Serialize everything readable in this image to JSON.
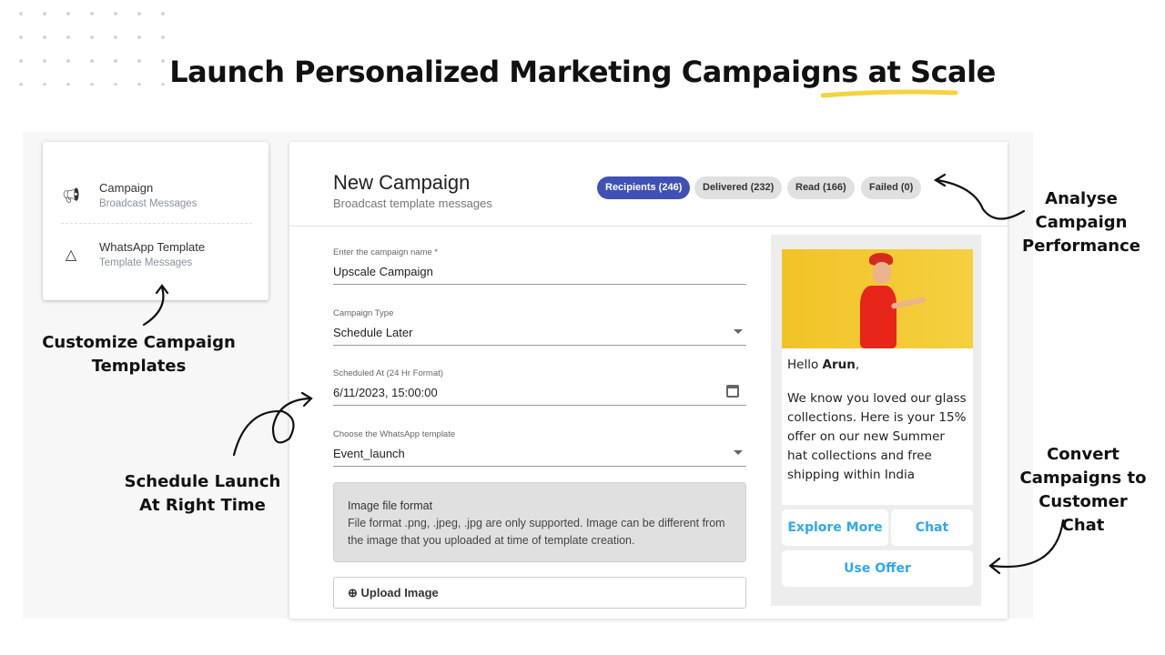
{
  "headline": "Launch Personalized Marketing Campaigns at Scale",
  "colors": {
    "accent": "#3f51b5",
    "highlight": "#f5d43a",
    "link": "#2fa8f0"
  },
  "nav": [
    {
      "icon": "megaphone-icon",
      "title": "Campaign",
      "subtitle": "Broadcast Messages"
    },
    {
      "icon": "shapes-icon",
      "title": "WhatsApp Template",
      "subtitle": "Template Messages"
    }
  ],
  "main": {
    "title": "New Campaign",
    "subtitle": "Broadcast template messages",
    "stats": [
      {
        "label": "Recipients  (246)",
        "active": true
      },
      {
        "label": "Delivered  (232)"
      },
      {
        "label": "Read  (166)"
      },
      {
        "label": "Failed  (0)"
      }
    ],
    "fields": [
      {
        "label": "Enter the campaign name *",
        "value": "Upscale Campaign"
      },
      {
        "label": "Campaign Type",
        "value": "Schedule Later"
      },
      {
        "label": "Scheduled At (24 Hr Format)",
        "value": "6/11/2023, 15:00:00"
      },
      {
        "label": "Choose the WhatsApp template",
        "value": "Event_launch"
      }
    ],
    "info_title": "Image file format",
    "info_text": "File format .png, .jpeg, .jpg are only supported. Image can be different from the image that you uploaded at time of template creation.",
    "upload_label": "Upload Image"
  },
  "preview": {
    "greeting": "Hello ",
    "name": "Arun",
    "comma": ",",
    "body": "We know you loved our glass collections. Here is your 15% offer on our new Summer hat collections and free shipping within India",
    "buttons": [
      "Explore More",
      "Chat",
      "Use Offer"
    ]
  },
  "annotations": {
    "templates": "Customize Campaign Templates",
    "schedule": "Schedule Launch At Right Time",
    "analyse": "Analyse Campaign Performance",
    "convert": "Convert Campaigns to Customer Chat"
  }
}
